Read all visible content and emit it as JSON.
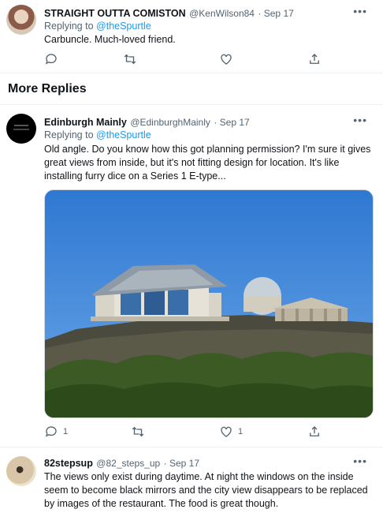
{
  "tweets": [
    {
      "name": "STRAIGHT OUTTA COMISTON",
      "handle": "@KenWilson84",
      "date": "· Sep 17",
      "replying_prefix": "Replying to",
      "replying_handle": "@theSpurtle",
      "text": "Carbuncle. Much-loved friend.",
      "more": "•••"
    },
    {
      "name": "Edinburgh Mainly",
      "handle": "@EdinburghMainly",
      "date": "· Sep 17",
      "replying_prefix": "Replying to",
      "replying_handle": "@theSpurtle",
      "text_lines": [
        "Old angle. Do you know how this got planning permission? I'm sure it gives",
        "great views from inside, but it's not fitting design for location. It's like",
        "installing furry dice on a Series 1 E-type..."
      ],
      "reply_count": "1",
      "like_count": "1",
      "more": "•••"
    },
    {
      "name": "82stepsup",
      "handle": "@82_steps_up",
      "date": "· Sep 17",
      "text_lines": [
        "The views only exist during daytime. At night the windows on the inside",
        "seem to become black mirrors and the city view disappears to be replaced",
        "by images of the restaurant. The food is great though."
      ],
      "more": "•••"
    }
  ],
  "section_title": "More Replies",
  "icons": [
    "reply-icon",
    "retweet-icon",
    "like-icon",
    "share-icon"
  ],
  "colors": {
    "link": "#1d9bf0",
    "muted": "#536471",
    "sky": "#3b82d6"
  }
}
